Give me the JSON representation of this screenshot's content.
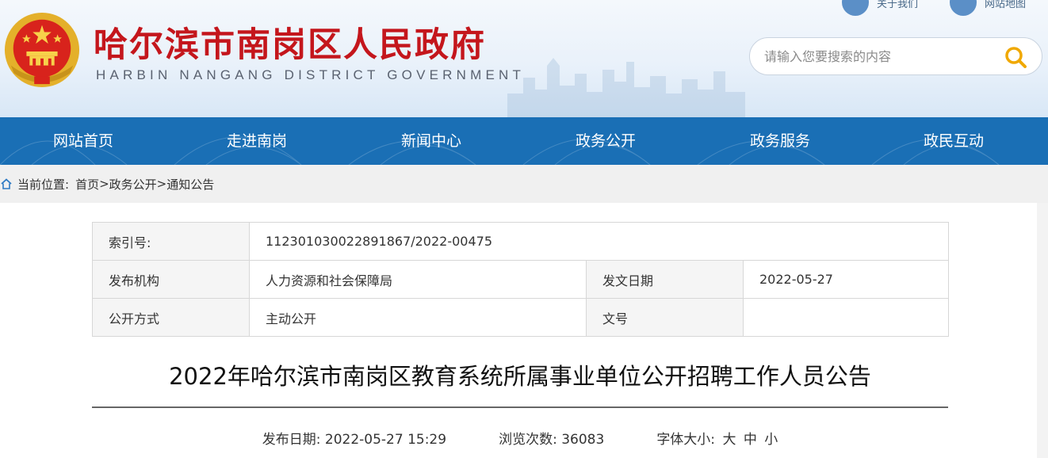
{
  "header": {
    "title": "哈尔滨市南岗区人民政府",
    "subtitle": "HARBIN NANGANG DISTRICT GOVERNMENT",
    "top_links": [
      "关于我们",
      "网站地图"
    ],
    "search": {
      "placeholder": "请输入您要搜索的内容"
    }
  },
  "nav": {
    "items": [
      "网站首页",
      "走进南岗",
      "新闻中心",
      "政务公开",
      "政务服务",
      "政民互动"
    ]
  },
  "breadcrumb": {
    "label": "当前位置:",
    "items": [
      "首页",
      "政务公开",
      "通知公告"
    ],
    "separator": ">"
  },
  "meta": {
    "index_label": "索引号:",
    "index_value": "112301030022891867/2022-00475",
    "publisher_label": "发布机构",
    "publisher_value": "人力资源和社会保障局",
    "date_label": "发文日期",
    "date_value": "2022-05-27",
    "mode_label": "公开方式",
    "mode_value": "主动公开",
    "docno_label": "文号",
    "docno_value": ""
  },
  "article": {
    "title": "2022年哈尔滨市南岗区教育系统所属事业单位公开招聘工作人员公告",
    "publish_label": "发布日期:",
    "publish_value": "2022-05-27 15:29",
    "views_label": "浏览次数:",
    "views_value": "36083",
    "fontsize_label": "字体大小:",
    "fontsize_options": [
      "大",
      "中",
      "小"
    ]
  },
  "colors": {
    "title_red": "#c4161c",
    "nav_blue": "#1a6fb5",
    "search_icon": "#f0a800"
  }
}
